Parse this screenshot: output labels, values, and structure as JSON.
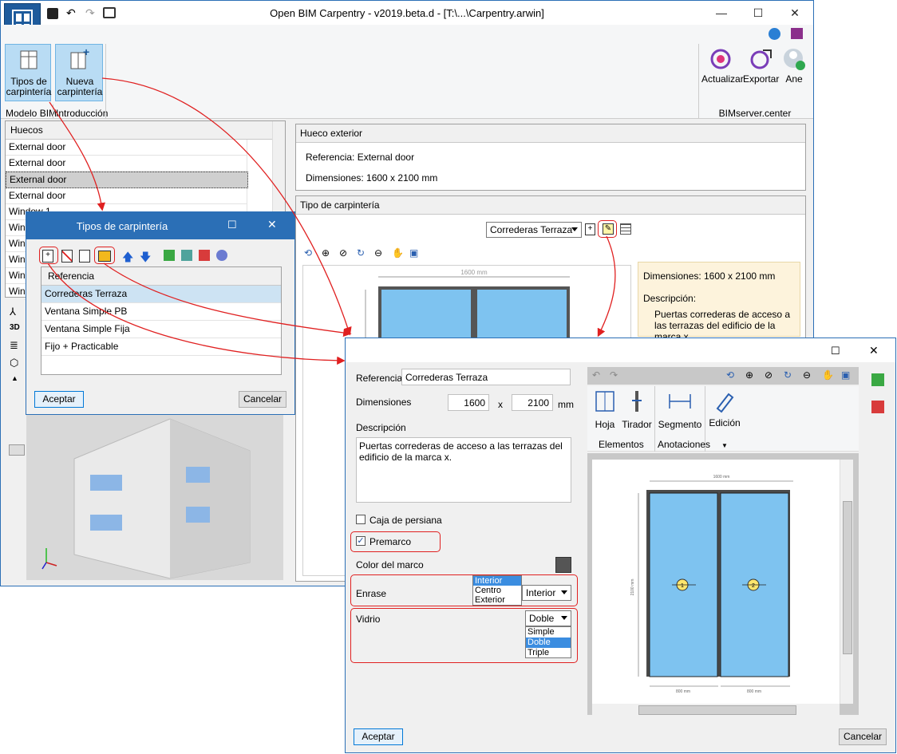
{
  "main_window": {
    "title": "Open BIM Carpentry - v2019.beta.d - [T:\\...\\Carpentry.arwin]",
    "ribbon": {
      "tipos_label": "Tipos de carpintería",
      "nueva_label": "Nueva carpintería",
      "group_modelo": "Modelo BIM",
      "group_intro": "Introducción",
      "actualizar": "Actualizar",
      "exportar": "Exportar",
      "user": "Ane",
      "group_bim": "BIMserver.center"
    },
    "huecos": {
      "header": "Huecos",
      "items": [
        "External door",
        "External door",
        "External door",
        "External door",
        "Window 1",
        "Wind",
        "Wind",
        "Wind",
        "Wind",
        "Wind"
      ]
    },
    "hueco_exterior": {
      "header": "Hueco exterior",
      "referencia": "Referencia: External door",
      "dimensiones": "Dimensiones: 1600 x 2100 mm"
    },
    "tipo_carpinteria": {
      "header": "Tipo de carpintería",
      "selected": "Correderas Terraza",
      "dim_label": "Dimensiones:",
      "dim_value": "1600 x 2100 mm",
      "desc_label": "Descripción:",
      "desc_value": "Puertas correderas de acceso a las terrazas del edificio de la marca x.",
      "width_dim": "1600 mm"
    }
  },
  "tipos_dialog": {
    "title": "Tipos de carpintería",
    "col_header": "Referencia",
    "items": [
      "Correderas Terraza",
      "Ventana Simple PB",
      "Ventana Simple Fija",
      "Fijo + Practicable"
    ],
    "accept": "Aceptar",
    "cancel": "Cancelar"
  },
  "edit_dialog": {
    "referencia_label": "Referencia",
    "referencia_value": "Correderas Terraza",
    "dimensiones_label": "Dimensiones",
    "width": "1600",
    "x": "x",
    "height": "2100",
    "unit": "mm",
    "descripcion_label": "Descripción",
    "descripcion_value": "Puertas correderas de acceso a las terrazas del edificio de la marca x.",
    "caja_label": "Caja de persiana",
    "premarco_label": "Premarco",
    "color_label": "Color del marco",
    "enrase_label": "Enrase",
    "enrase_options": [
      "Interior",
      "Centro",
      "Exterior"
    ],
    "enrase_selected": "Interior",
    "vidrio_label": "Vidrio",
    "vidrio_selected": "Doble",
    "vidrio_options": [
      "Simple",
      "Doble",
      "Triple"
    ],
    "ribbon": {
      "hoja": "Hoja",
      "tirador": "Tirador",
      "segmento": "Segmento",
      "edicion": "Edición",
      "group_elementos": "Elementos",
      "group_anotaciones": "Anotaciones"
    },
    "drawing": {
      "top_dim": "1600 mm",
      "left_dim": "2100 mm",
      "bottom_left": "800 mm",
      "bottom_right": "800 mm",
      "marker_1": "1",
      "marker_2": "2"
    },
    "accept": "Aceptar",
    "cancel": "Cancelar"
  },
  "colors": {
    "accent": "#0078d7",
    "highlight_red": "#e02020",
    "glass": "#7ec3f0",
    "frame": "#555555",
    "info_bg": "#fdf3dc"
  }
}
